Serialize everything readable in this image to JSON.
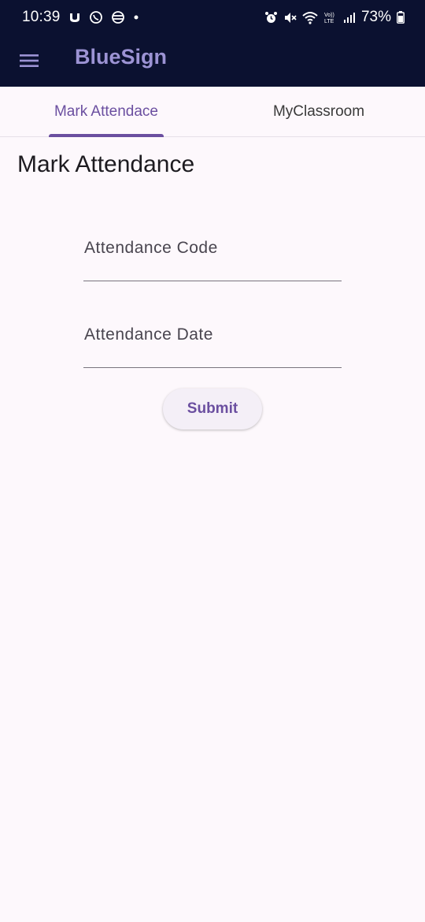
{
  "status_bar": {
    "time": "10:39",
    "battery": "73%",
    "left_icons": [
      "notification-app-icon",
      "whatsapp-icon",
      "browser-icon",
      "dot-icon"
    ],
    "right_icons": [
      "alarm-icon",
      "mute-icon",
      "wifi-icon",
      "volte-icon",
      "signal-icon",
      "battery-icon"
    ],
    "volte_label": "Vo)) LTE"
  },
  "app_bar": {
    "menu_icon": "hamburger-menu-icon",
    "title": "BlueSign"
  },
  "tabs": [
    {
      "label": "Mark Attendace",
      "active": true
    },
    {
      "label": "MyClassroom",
      "active": false
    }
  ],
  "page": {
    "title": "Mark Attendance"
  },
  "form": {
    "attendance_code": {
      "label": "Attendance Code",
      "value": ""
    },
    "attendance_date": {
      "label": "Attendance Date",
      "value": ""
    },
    "submit_label": "Submit"
  },
  "colors": {
    "app_bar_bg": "#0b1130",
    "title_color": "#9c93d4",
    "accent": "#6b4fa0",
    "background": "#fdf8fc"
  }
}
